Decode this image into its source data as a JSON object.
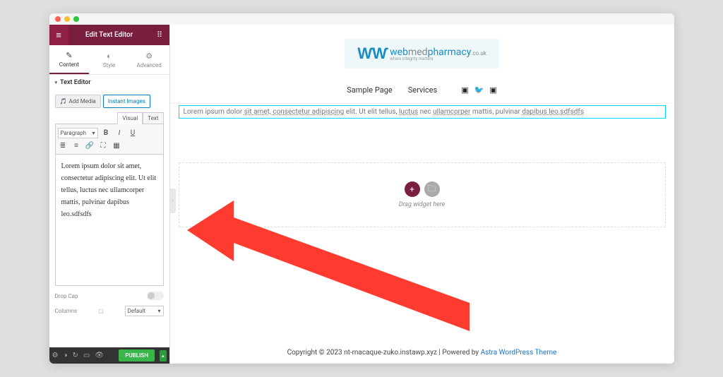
{
  "header": {
    "title": "Edit Text Editor"
  },
  "tabs": {
    "content": "Content",
    "style": "Style",
    "advanced": "Advanced"
  },
  "section": {
    "title": "Text Editor"
  },
  "editor": {
    "addMedia": "Add Media",
    "instantImages": "Instant Images",
    "vis": "Visual",
    "txt": "Text",
    "format": "Paragraph",
    "content": "Lorem ipsum dolor sit amet, consectetur adipiscing elit. Ut elit tellus, luctus nec ullamcorper mattis, pulvinar dapibus leo.sdfsdfs"
  },
  "dropCap": {
    "label": "Drop Cap"
  },
  "columns": {
    "label": "Columns",
    "value": "Default"
  },
  "publish": {
    "label": "PUBLISH"
  },
  "nav": {
    "item1": "Sample Page",
    "item2": "Services"
  },
  "logo": {
    "brand1": "web",
    "brand2": "med",
    "brand3": "pharmacy",
    "suffix": ".co.uk",
    "tagline": "where integrity matters"
  },
  "canvasText": {
    "p1": "Lorem ipsum dolor ",
    "u1": "sit amet, consectetur adipiscing",
    "p2": " elit. Ut elit tellus, ",
    "u2": "luctus",
    "p3": " nec ",
    "u3": "ullamcorper",
    "p4": " mattis, pulvinar ",
    "u4": "dapibus leo.sdfsdfs"
  },
  "dropzone": {
    "label": "Drag widget here"
  },
  "footer": {
    "text": "Copyright © 2023 nt-macaque-zuko.instawp.xyz | Powered by ",
    "link": "Astra WordPress Theme"
  }
}
